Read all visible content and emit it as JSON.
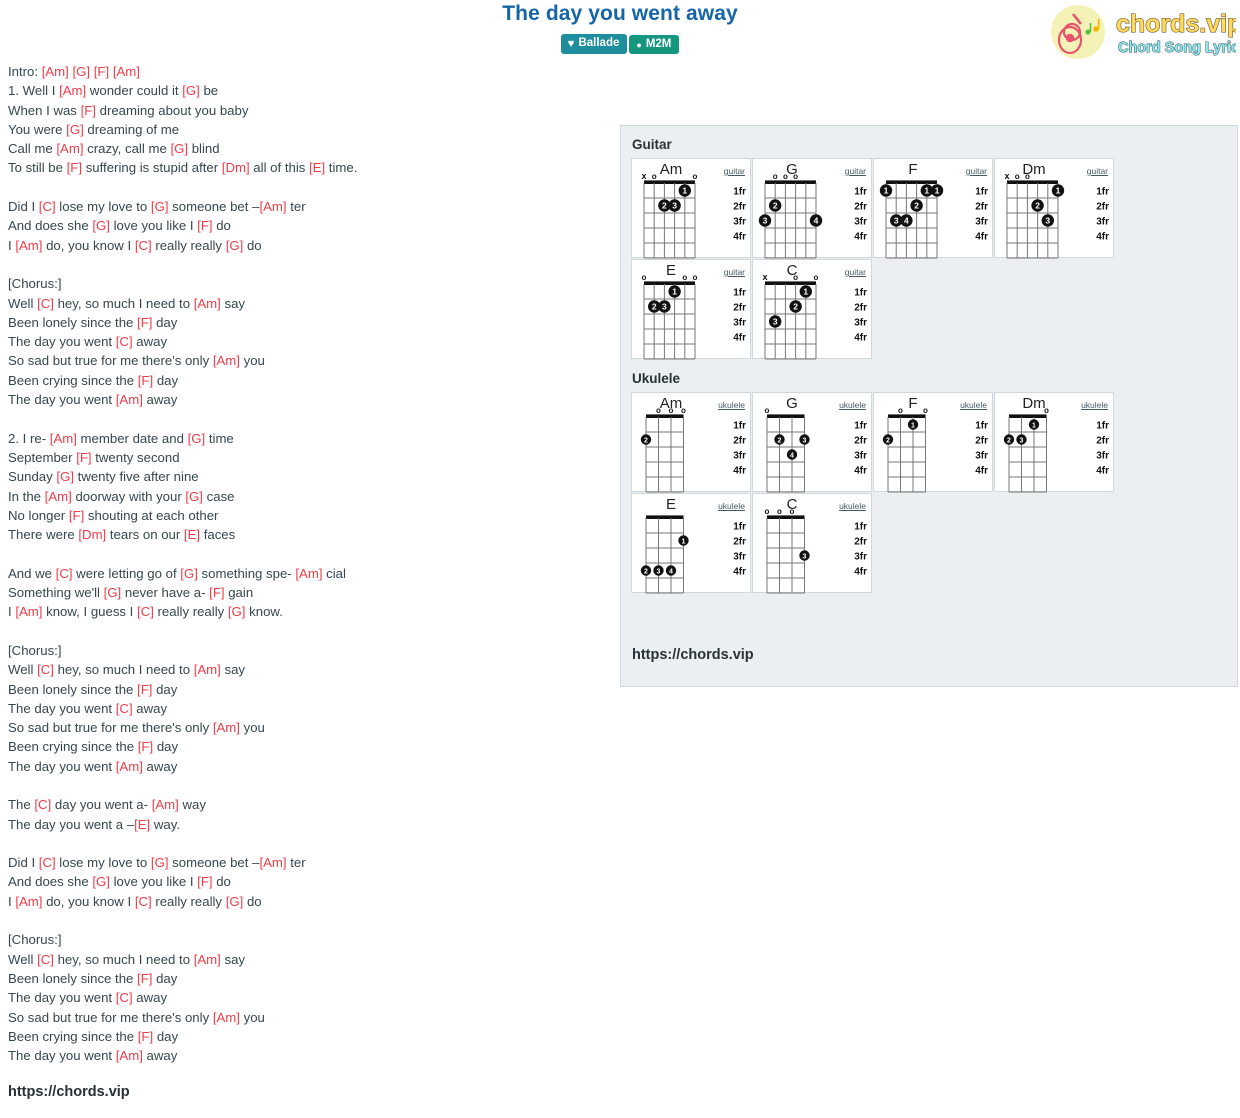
{
  "header": {
    "title": "The day you went away",
    "badges": [
      {
        "label": "Ballade",
        "icon": "heart-card-icon",
        "color": "#1e8e9e"
      },
      {
        "label": "M2M",
        "icon": "user-icon",
        "color": "#14967f"
      }
    ],
    "logo": {
      "name": "chords.vip",
      "tagline": "Chord Song Lyric",
      "circle_color": "#f5f2b8",
      "guitar_color": "#e8536b",
      "name_color": "#ffd95e",
      "tagline_color": "#8fe8f0"
    }
  },
  "lyrics": {
    "chord_color": "#ef3e4a",
    "text_color": "#37474f",
    "lines": [
      [
        {
          "t": "Intro: "
        },
        {
          "c": "[Am]"
        },
        {
          "t": " "
        },
        {
          "c": "[G]"
        },
        {
          "t": " "
        },
        {
          "c": "[F]"
        },
        {
          "t": " "
        },
        {
          "c": "[Am]"
        }
      ],
      [
        {
          "t": "1. Well I "
        },
        {
          "c": "[Am]"
        },
        {
          "t": " wonder could it "
        },
        {
          "c": "[G]"
        },
        {
          "t": " be"
        }
      ],
      [
        {
          "t": "When I was "
        },
        {
          "c": "[F]"
        },
        {
          "t": " dreaming about you baby"
        }
      ],
      [
        {
          "t": "You were "
        },
        {
          "c": "[G]"
        },
        {
          "t": " dreaming of me"
        }
      ],
      [
        {
          "t": "Call me "
        },
        {
          "c": "[Am]"
        },
        {
          "t": " crazy, call me "
        },
        {
          "c": "[G]"
        },
        {
          "t": " blind"
        }
      ],
      [
        {
          "t": "To still be "
        },
        {
          "c": "[F]"
        },
        {
          "t": " suffering is stupid after "
        },
        {
          "c": "[Dm]"
        },
        {
          "t": " all of this "
        },
        {
          "c": "[E]"
        },
        {
          "t": " time."
        }
      ],
      [
        {
          "t": ""
        }
      ],
      [
        {
          "t": "Did I "
        },
        {
          "c": "[C]"
        },
        {
          "t": " lose my love to "
        },
        {
          "c": "[G]"
        },
        {
          "t": " someone bet –"
        },
        {
          "c": "[Am]"
        },
        {
          "t": " ter"
        }
      ],
      [
        {
          "t": "And does she "
        },
        {
          "c": "[G]"
        },
        {
          "t": " love you like I "
        },
        {
          "c": "[F]"
        },
        {
          "t": " do"
        }
      ],
      [
        {
          "t": "I "
        },
        {
          "c": "[Am]"
        },
        {
          "t": " do, you know I "
        },
        {
          "c": "[C]"
        },
        {
          "t": " really really "
        },
        {
          "c": "[G]"
        },
        {
          "t": " do"
        }
      ],
      [
        {
          "t": ""
        }
      ],
      [
        {
          "t": "[Chorus:]"
        }
      ],
      [
        {
          "t": "Well "
        },
        {
          "c": "[C]"
        },
        {
          "t": " hey, so much I need to "
        },
        {
          "c": "[Am]"
        },
        {
          "t": " say"
        }
      ],
      [
        {
          "t": "Been lonely since the "
        },
        {
          "c": "[F]"
        },
        {
          "t": " day"
        }
      ],
      [
        {
          "t": "The day you went "
        },
        {
          "c": "[C]"
        },
        {
          "t": " away"
        }
      ],
      [
        {
          "t": "So sad but true for me there's only "
        },
        {
          "c": "[Am]"
        },
        {
          "t": " you"
        }
      ],
      [
        {
          "t": "Been crying since the "
        },
        {
          "c": "[F]"
        },
        {
          "t": " day"
        }
      ],
      [
        {
          "t": "The day you went "
        },
        {
          "c": "[Am]"
        },
        {
          "t": " away"
        }
      ],
      [
        {
          "t": ""
        }
      ],
      [
        {
          "t": "2. I re- "
        },
        {
          "c": "[Am]"
        },
        {
          "t": " member date and "
        },
        {
          "c": "[G]"
        },
        {
          "t": " time"
        }
      ],
      [
        {
          "t": "September "
        },
        {
          "c": "[F]"
        },
        {
          "t": " twenty second"
        }
      ],
      [
        {
          "t": "Sunday "
        },
        {
          "c": "[G]"
        },
        {
          "t": " twenty five after nine"
        }
      ],
      [
        {
          "t": "In the "
        },
        {
          "c": "[Am]"
        },
        {
          "t": " doorway with your "
        },
        {
          "c": "[G]"
        },
        {
          "t": " case"
        }
      ],
      [
        {
          "t": "No longer "
        },
        {
          "c": "[F]"
        },
        {
          "t": " shouting at each other"
        }
      ],
      [
        {
          "t": "There were "
        },
        {
          "c": "[Dm]"
        },
        {
          "t": " tears on our "
        },
        {
          "c": "[E]"
        },
        {
          "t": " faces"
        }
      ],
      [
        {
          "t": ""
        }
      ],
      [
        {
          "t": "And we "
        },
        {
          "c": "[C]"
        },
        {
          "t": " were letting go of "
        },
        {
          "c": "[G]"
        },
        {
          "t": " something spe- "
        },
        {
          "c": "[Am]"
        },
        {
          "t": " cial"
        }
      ],
      [
        {
          "t": "Something we'll "
        },
        {
          "c": "[G]"
        },
        {
          "t": " never have a- "
        },
        {
          "c": "[F]"
        },
        {
          "t": " gain"
        }
      ],
      [
        {
          "t": "I "
        },
        {
          "c": "[Am]"
        },
        {
          "t": " know, I guess I "
        },
        {
          "c": "[C]"
        },
        {
          "t": " really really "
        },
        {
          "c": "[G]"
        },
        {
          "t": " know."
        }
      ],
      [
        {
          "t": ""
        }
      ],
      [
        {
          "t": "[Chorus:]"
        }
      ],
      [
        {
          "t": "Well "
        },
        {
          "c": "[C]"
        },
        {
          "t": " hey, so much I need to "
        },
        {
          "c": "[Am]"
        },
        {
          "t": " say"
        }
      ],
      [
        {
          "t": "Been lonely since the "
        },
        {
          "c": "[F]"
        },
        {
          "t": " day"
        }
      ],
      [
        {
          "t": "The day you went "
        },
        {
          "c": "[C]"
        },
        {
          "t": " away"
        }
      ],
      [
        {
          "t": "So sad but true for me there's only "
        },
        {
          "c": "[Am]"
        },
        {
          "t": " you"
        }
      ],
      [
        {
          "t": "Been crying since the "
        },
        {
          "c": "[F]"
        },
        {
          "t": " day"
        }
      ],
      [
        {
          "t": "The day you went "
        },
        {
          "c": "[Am]"
        },
        {
          "t": " away"
        }
      ],
      [
        {
          "t": ""
        }
      ],
      [
        {
          "t": "The "
        },
        {
          "c": "[C]"
        },
        {
          "t": " day you went a- "
        },
        {
          "c": "[Am]"
        },
        {
          "t": " way"
        }
      ],
      [
        {
          "t": "The day you went a –"
        },
        {
          "c": "[E]"
        },
        {
          "t": " way."
        }
      ],
      [
        {
          "t": ""
        }
      ],
      [
        {
          "t": "Did I "
        },
        {
          "c": "[C]"
        },
        {
          "t": " lose my love to "
        },
        {
          "c": "[G]"
        },
        {
          "t": " someone bet –"
        },
        {
          "c": "[Am]"
        },
        {
          "t": " ter"
        }
      ],
      [
        {
          "t": "And does she "
        },
        {
          "c": "[G]"
        },
        {
          "t": " love you like I "
        },
        {
          "c": "[F]"
        },
        {
          "t": " do"
        }
      ],
      [
        {
          "t": "I "
        },
        {
          "c": "[Am]"
        },
        {
          "t": " do, you know I "
        },
        {
          "c": "[C]"
        },
        {
          "t": " really really "
        },
        {
          "c": "[G]"
        },
        {
          "t": " do"
        }
      ],
      [
        {
          "t": ""
        }
      ],
      [
        {
          "t": "[Chorus:]"
        }
      ],
      [
        {
          "t": "Well "
        },
        {
          "c": "[C]"
        },
        {
          "t": " hey, so much I need to "
        },
        {
          "c": "[Am]"
        },
        {
          "t": " say"
        }
      ],
      [
        {
          "t": "Been lonely since the "
        },
        {
          "c": "[F]"
        },
        {
          "t": " day"
        }
      ],
      [
        {
          "t": "The day you went "
        },
        {
          "c": "[C]"
        },
        {
          "t": " away"
        }
      ],
      [
        {
          "t": "So sad but true for me there's only "
        },
        {
          "c": "[Am]"
        },
        {
          "t": " you"
        }
      ],
      [
        {
          "t": "Been crying since the "
        },
        {
          "c": "[F]"
        },
        {
          "t": " day"
        }
      ],
      [
        {
          "t": "The day you went "
        },
        {
          "c": "[Am]"
        },
        {
          "t": " away"
        }
      ]
    ]
  },
  "bottom_url": "https://chords.vip",
  "chord_panel": {
    "url": "https://chords.vip",
    "sections": [
      {
        "title": "Guitar",
        "instrument_label": "guitar",
        "strings": 6,
        "frets": [
          "1fr",
          "2fr",
          "3fr",
          "4fr"
        ],
        "chords": [
          {
            "name": "Am",
            "open": [
              "x",
              "o",
              "",
              "",
              "",
              "o"
            ],
            "dots": [
              {
                "s": 5,
                "f": 1,
                "n": "1"
              },
              {
                "s": 3,
                "f": 2,
                "n": "2"
              },
              {
                "s": 4,
                "f": 2,
                "n": "3"
              }
            ]
          },
          {
            "name": "G",
            "open": [
              "",
              "o",
              "o",
              "o",
              "",
              ""
            ],
            "dots": [
              {
                "s": 1,
                "f": 3,
                "n": "3"
              },
              {
                "s": 2,
                "f": 2,
                "n": "2"
              },
              {
                "s": 6,
                "f": 3,
                "n": "4"
              }
            ]
          },
          {
            "name": "F",
            "open": [
              "",
              "",
              "",
              "",
              "",
              ""
            ],
            "dots": [
              {
                "s": 1,
                "f": 1,
                "n": "1"
              },
              {
                "s": 5,
                "f": 1,
                "n": "1"
              },
              {
                "s": 6,
                "f": 1,
                "n": "1"
              },
              {
                "s": 4,
                "f": 2,
                "n": "2"
              },
              {
                "s": 2,
                "f": 3,
                "n": "3"
              },
              {
                "s": 3,
                "f": 3,
                "n": "4"
              }
            ]
          },
          {
            "name": "Dm",
            "open": [
              "x",
              "o",
              "o",
              "",
              "",
              ""
            ],
            "dots": [
              {
                "s": 6,
                "f": 1,
                "n": "1"
              },
              {
                "s": 4,
                "f": 2,
                "n": "2"
              },
              {
                "s": 5,
                "f": 3,
                "n": "3"
              }
            ]
          },
          {
            "name": "E",
            "open": [
              "o",
              "",
              "",
              "",
              "o",
              "o"
            ],
            "dots": [
              {
                "s": 4,
                "f": 1,
                "n": "1"
              },
              {
                "s": 2,
                "f": 2,
                "n": "2"
              },
              {
                "s": 3,
                "f": 2,
                "n": "3"
              }
            ]
          },
          {
            "name": "C",
            "open": [
              "x",
              "",
              "",
              "o",
              "",
              "o"
            ],
            "dots": [
              {
                "s": 5,
                "f": 1,
                "n": "1"
              },
              {
                "s": 4,
                "f": 2,
                "n": "2"
              },
              {
                "s": 2,
                "f": 3,
                "n": "3"
              }
            ]
          }
        ]
      },
      {
        "title": "Ukulele",
        "instrument_label": "ukulele",
        "strings": 4,
        "frets": [
          "1fr",
          "2fr",
          "3fr",
          "4fr"
        ],
        "chords": [
          {
            "name": "Am",
            "open": [
              "",
              "o",
              "o",
              "o"
            ],
            "dots": [
              {
                "s": 1,
                "f": 2,
                "n": "2"
              }
            ]
          },
          {
            "name": "G",
            "open": [
              "o",
              "",
              "",
              ""
            ],
            "dots": [
              {
                "s": 2,
                "f": 2,
                "n": "2"
              },
              {
                "s": 4,
                "f": 2,
                "n": "3"
              },
              {
                "s": 3,
                "f": 3,
                "n": "4"
              }
            ]
          },
          {
            "name": "F",
            "open": [
              "",
              "o",
              "",
              "o"
            ],
            "dots": [
              {
                "s": 3,
                "f": 1,
                "n": "1"
              },
              {
                "s": 1,
                "f": 2,
                "n": "2"
              }
            ]
          },
          {
            "name": "Dm",
            "open": [
              "",
              "",
              "",
              "o"
            ],
            "dots": [
              {
                "s": 3,
                "f": 1,
                "n": "1"
              },
              {
                "s": 1,
                "f": 2,
                "n": "2"
              },
              {
                "s": 2,
                "f": 2,
                "n": "3"
              }
            ]
          },
          {
            "name": "E",
            "open": [
              "",
              "",
              "",
              ""
            ],
            "dots": [
              {
                "s": 4,
                "f": 2,
                "n": "1"
              },
              {
                "s": 1,
                "f": 4,
                "n": "2"
              },
              {
                "s": 2,
                "f": 4,
                "n": "3"
              },
              {
                "s": 3,
                "f": 4,
                "n": "4"
              }
            ]
          },
          {
            "name": "C",
            "open": [
              "o",
              "o",
              "o",
              ""
            ],
            "dots": [
              {
                "s": 4,
                "f": 3,
                "n": "3"
              }
            ]
          }
        ]
      }
    ]
  }
}
